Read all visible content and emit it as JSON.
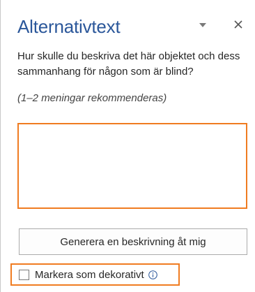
{
  "pane": {
    "title": "Alternativtext",
    "question": "Hur skulle du beskriva det här objektet och dess sammanhang för någon som är blind?",
    "hint": "(1–2 meningar rekommenderas)",
    "description_value": "",
    "generate_button_label": "Generera en beskrivning åt mig",
    "decorative_label": "Markera som dekorativt",
    "decorative_checked": false
  },
  "icons": {
    "dropdown": "chevron-down-icon",
    "close": "close-icon",
    "info": "info-icon"
  },
  "colors": {
    "title": "#2b579a",
    "highlight_border": "#f07c21",
    "info_icon": "#2b579a"
  }
}
